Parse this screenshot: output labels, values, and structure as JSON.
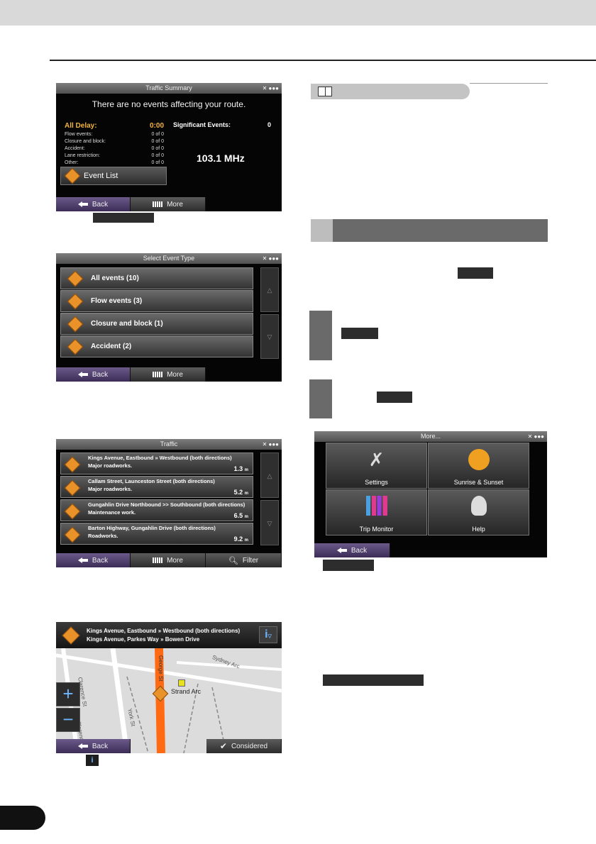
{
  "s1": {
    "title": "Traffic Summary",
    "msg": "There are no events affecting your route.",
    "all_delay_label": "All Delay:",
    "all_delay_value": "0:00",
    "rows": [
      {
        "label": "Flow events:",
        "value": "0 of 0"
      },
      {
        "label": "Closure and block:",
        "value": "0 of 0"
      },
      {
        "label": "Accident:",
        "value": "0 of 0"
      },
      {
        "label": "Lane restriction:",
        "value": "0 of 0"
      },
      {
        "label": "Other:",
        "value": "0 of 0"
      }
    ],
    "sig_label": "Significant Events:",
    "sig_value": "0",
    "freq": "103.1 MHz",
    "event_list": "Event List",
    "back": "Back",
    "more": "More"
  },
  "s2": {
    "title": "Select Event Type",
    "items": [
      "All events (10)",
      "Flow events (3)",
      "Closure and block (1)",
      "Accident (2)"
    ],
    "back": "Back",
    "more": "More"
  },
  "s3": {
    "title": "Traffic",
    "rows": [
      {
        "l1a": "Kings Avenue, Eastbound",
        "sep": "»",
        "l1b": "Westbound (both directions)",
        "l2": "Major roadworks.",
        "dist": "1.3",
        "unit": "m"
      },
      {
        "l1a": "Callam Street, Launceston Street (both directions)",
        "sep": "",
        "l1b": "",
        "l2": "Major roadworks.",
        "dist": "5.2",
        "unit": "m"
      },
      {
        "l1a": "Gungahlin Drive Northbound",
        "sep": ">>",
        "l1b": "Southbound (both directions)",
        "l2": "Maintenance work.",
        "dist": "6.5",
        "unit": "m"
      },
      {
        "l1a": "Barton Highway, Gungahlin Drive (both directions)",
        "sep": "",
        "l1b": "",
        "l2": "Roadworks.",
        "dist": "9.2",
        "unit": "m"
      }
    ],
    "back": "Back",
    "more": "More",
    "filter": "Filter"
  },
  "s4": {
    "line1a": "Kings Avenue, Eastbound",
    "line1sep": "»",
    "line1b": "Westbound (both directions)",
    "line2a": "Kings Avenue, Parkes Way",
    "line2sep": "»",
    "line2b": "Bowen Drive",
    "info": "i",
    "streets": [
      "Clarence St",
      "York St",
      "George St",
      "Sydney Arc",
      "Strand Arc",
      "Clarence St"
    ],
    "back": "Back",
    "considered": "Considered"
  },
  "s5": {
    "title": "More...",
    "tiles": [
      "Settings",
      "Sunrise & Sunset",
      "Trip Monitor",
      "Help"
    ],
    "back": "Back"
  },
  "colors": {
    "accent": "#f2b33d",
    "back_button": "#4a3a6a",
    "road": "#ff6a13"
  }
}
